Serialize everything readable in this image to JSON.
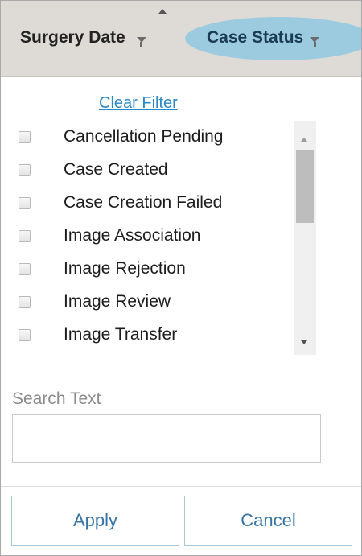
{
  "header": {
    "columns": [
      {
        "label": "Surgery Date",
        "filter_icon": "filter-icon"
      },
      {
        "label": "Case Status",
        "filter_icon": "filter-icon"
      }
    ],
    "sort_icon": "sort-ascending-icon",
    "highlight_color": "#9ccbe0"
  },
  "filter": {
    "clear_label": "Clear Filter",
    "options": [
      {
        "label": "Cancellation Pending",
        "checked": false
      },
      {
        "label": "Case Created",
        "checked": false
      },
      {
        "label": "Case Creation Failed",
        "checked": false
      },
      {
        "label": "Image Association",
        "checked": false
      },
      {
        "label": "Image Rejection",
        "checked": false
      },
      {
        "label": "Image Review",
        "checked": false
      },
      {
        "label": "Image Transfer",
        "checked": false
      }
    ],
    "search_label": "Search Text",
    "search_value": "",
    "apply_label": "Apply",
    "cancel_label": "Cancel",
    "accent_color": "#2b88c9"
  }
}
